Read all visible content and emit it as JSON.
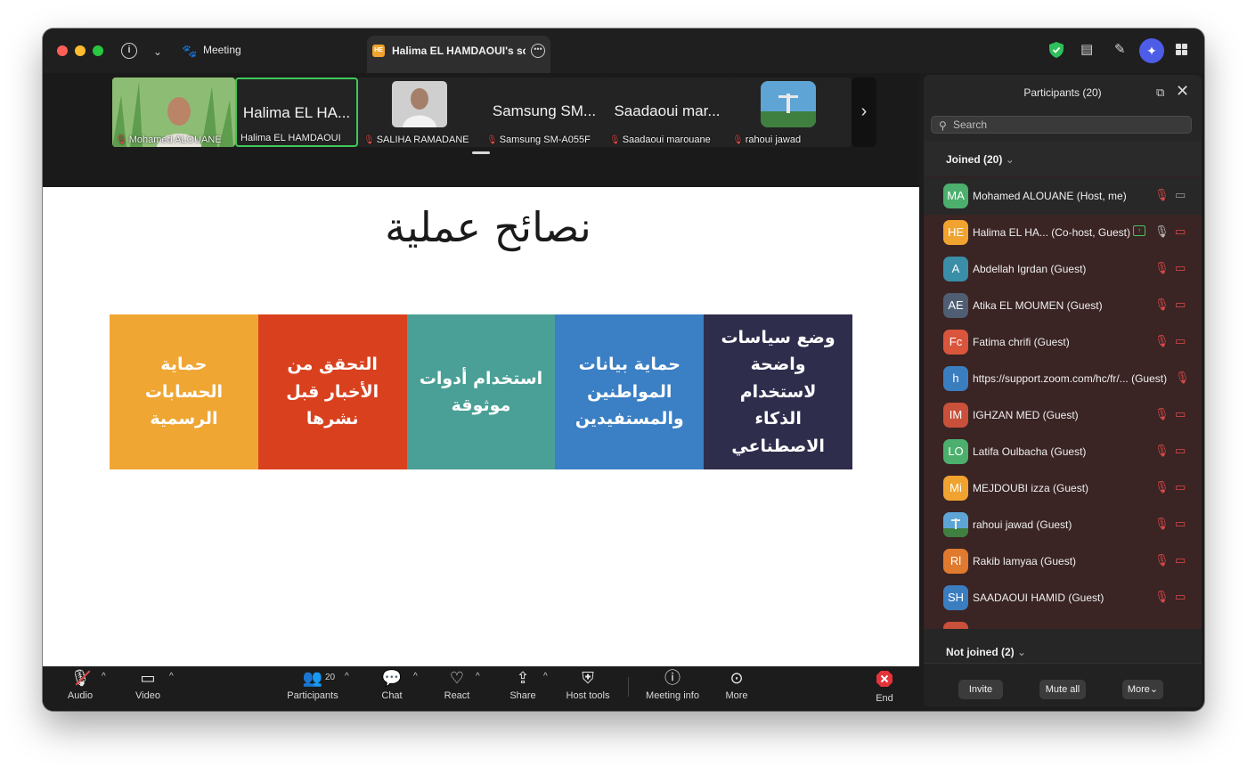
{
  "titlebar": {
    "meeting_label": "Meeting",
    "share_tab_badge": "HE",
    "share_tab_title": "Halima EL HAMDAOUI's scre"
  },
  "strip": {
    "tiles": [
      {
        "name": "Mohamed ALOUANE",
        "big": ""
      },
      {
        "name": "Halima EL HAMDAOUI",
        "big": "Halima EL HA..."
      },
      {
        "name": "SALIHA RAMADANE",
        "big": ""
      },
      {
        "name": "Samsung SM-A055F",
        "big": "Samsung SM..."
      },
      {
        "name": "Saadaoui marouane",
        "big": "Saadaoui mar..."
      },
      {
        "name": "rahoui jawad",
        "big": ""
      }
    ]
  },
  "slide": {
    "title": "نصائح عملية",
    "boxes": [
      {
        "text": "حماية الحسابات الرسمية",
        "color": "#f0a633"
      },
      {
        "text": "التحقق من الأخبار قبل نشرها",
        "color": "#d9411e"
      },
      {
        "text": "استخدام أدوات موثوقة",
        "color": "#4aa096"
      },
      {
        "text": "حماية بيانات المواطنين والمستفيدين",
        "color": "#3b7fc4"
      },
      {
        "text": "وضع سياسات واضحة لاستخدام الذكاء الاصطناعي",
        "color": "#2e2d4c"
      }
    ]
  },
  "panel": {
    "title": "Participants (20)",
    "search_placeholder": "Search",
    "joined_label": "Joined (20)",
    "not_joined_label": "Not joined (2)",
    "participants": [
      {
        "initials": "MA",
        "name": "Mohamed ALOUANE (Host, me)",
        "color": "#4caf6d"
      },
      {
        "initials": "HE",
        "name": "Halima EL HA...  (Co-host, Guest)",
        "color": "#f0a32f"
      },
      {
        "initials": "A",
        "name": "Abdellah Igrdan (Guest)",
        "color": "#3a8ea8"
      },
      {
        "initials": "AE",
        "name": "Atika EL MOUMEN (Guest)",
        "color": "#4f5e73"
      },
      {
        "initials": "Fc",
        "name": "Fatima chrifi (Guest)",
        "color": "#d9553b"
      },
      {
        "initials": "h",
        "name": "https://support.zoom.com/hc/fr/...   (Guest)",
        "color": "#3b7ec0"
      },
      {
        "initials": "IM",
        "name": "IGHZAN MED (Guest)",
        "color": "#c9503a"
      },
      {
        "initials": "LO",
        "name": "Latifa Oulbacha (Guest)",
        "color": "#4caf6d"
      },
      {
        "initials": "Mi",
        "name": "MEJDOUBI  izza (Guest)",
        "color": "#f0a32f"
      },
      {
        "initials": "",
        "name": "rahoui jawad (Guest)",
        "color": "#5b8fb8"
      },
      {
        "initials": "Rl",
        "name": "Rakib lamyaa (Guest)",
        "color": "#e07a2e"
      },
      {
        "initials": "SH",
        "name": "SAADAOUI HAMID (Guest)",
        "color": "#3b7ec0"
      }
    ],
    "invite_label": "Invite",
    "mute_all_label": "Mute all",
    "more_label": "More"
  },
  "toolbar": {
    "audio": "Audio",
    "video": "Video",
    "participants": "Participants",
    "participants_count": "20",
    "chat": "Chat",
    "react": "React",
    "share": "Share",
    "host_tools": "Host tools",
    "meeting_info": "Meeting info",
    "more": "More",
    "end": "End"
  }
}
